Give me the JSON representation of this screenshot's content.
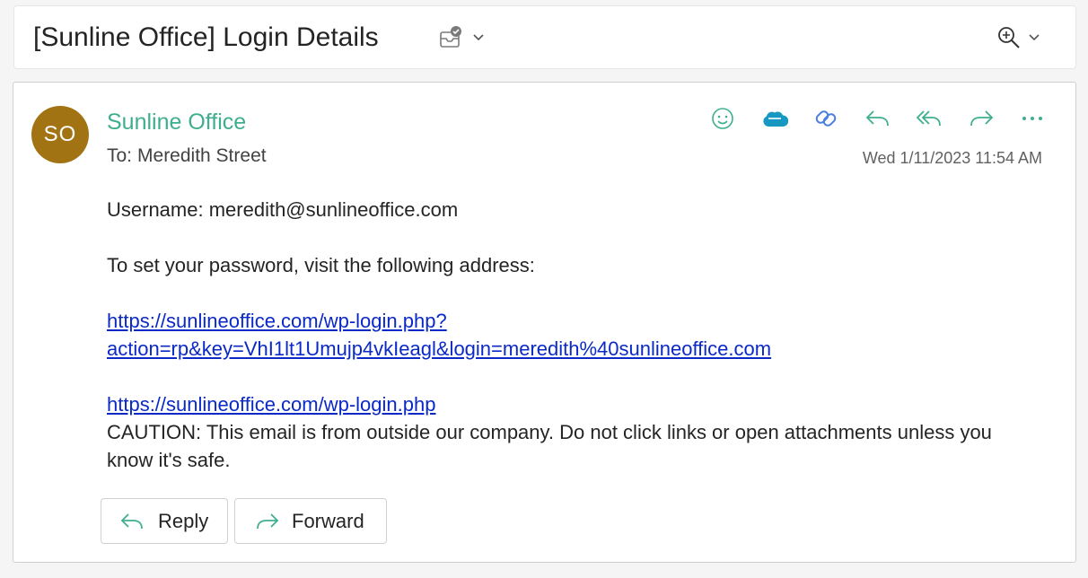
{
  "subject": {
    "title": "[Sunline Office] Login Details",
    "tag_icon": "envelope-check-icon",
    "zoom_icon": "zoom-in-icon"
  },
  "message": {
    "avatar_initials": "SO",
    "avatar_color": "#a27313",
    "sender": "Sunline Office",
    "sender_color": "#3fae8f",
    "to_label": "To:",
    "to_name": "Meredith Street",
    "timestamp": "Wed 1/11/2023 11:54 AM",
    "actions": [
      {
        "name": "emoji-icon"
      },
      {
        "name": "salesforce-icon"
      },
      {
        "name": "viva-insights-icon"
      },
      {
        "name": "reply-icon"
      },
      {
        "name": "reply-all-icon"
      },
      {
        "name": "forward-icon"
      },
      {
        "name": "more-icon"
      }
    ],
    "body": {
      "username_line": "Username: meredith@sunlineoffice.com",
      "instruction": "To set your password, visit the following address:",
      "reset_link_line1": "https://sunlineoffice.com/wp-login.php?",
      "reset_link_line2": "action=rp&key=VhI1lt1Umujp4vkIeagl&login=meredith%40sunlineoffice.com",
      "login_link": "https://sunlineoffice.com/wp-login.php",
      "caution": "CAUTION: This email is from outside our company. Do not click links or open attachments unless you know it's safe."
    },
    "reply_label": "Reply",
    "forward_label": "Forward"
  }
}
